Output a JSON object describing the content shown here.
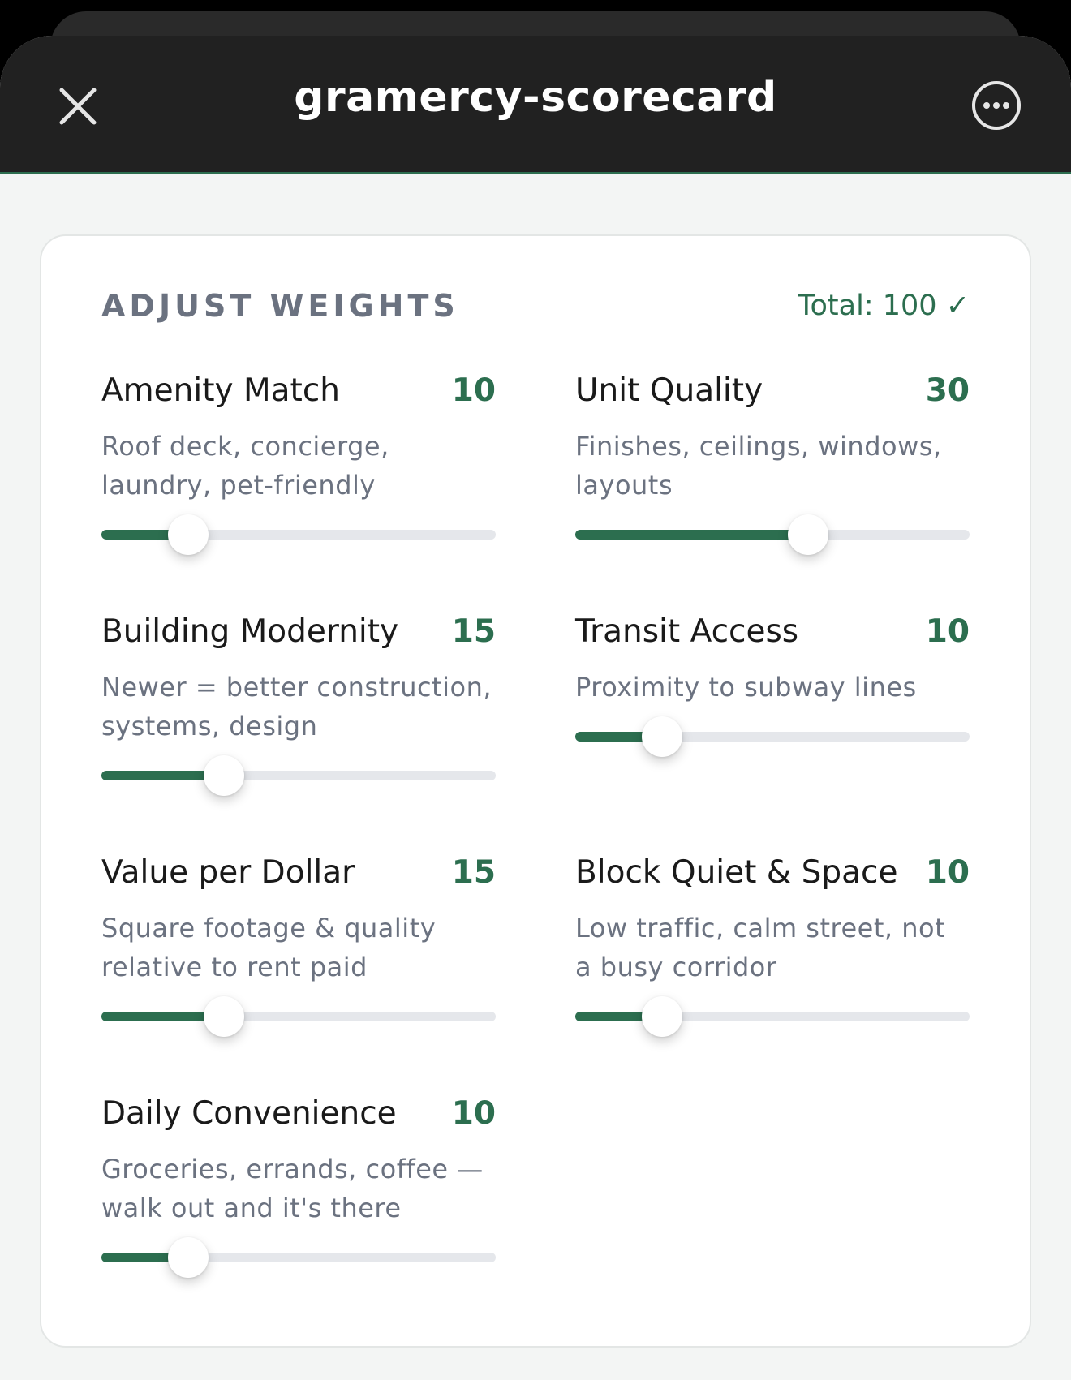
{
  "app": {
    "title": "gramercy-scorecard",
    "icons": {
      "close": "close-icon",
      "more": "more-options-icon"
    }
  },
  "card": {
    "section_label": "ADJUST WEIGHTS",
    "total_text": "Total: 100 ✓"
  },
  "weights": [
    {
      "name": "Amenity Match",
      "value": "10",
      "desc": "Roof deck, concierge, laundry, pet-friendly",
      "fraction": 0.22
    },
    {
      "name": "Unit Quality",
      "value": "30",
      "desc": "Finishes, ceilings, windows, layouts",
      "fraction": 0.59
    },
    {
      "name": "Building Modernity",
      "value": "15",
      "desc": "Newer = better construction, systems, design",
      "fraction": 0.31
    },
    {
      "name": "Transit Access",
      "value": "10",
      "desc": "Proximity to subway lines",
      "fraction": 0.22
    },
    {
      "name": "Value per Dollar",
      "value": "15",
      "desc": "Square footage & quality relative to rent paid",
      "fraction": 0.31
    },
    {
      "name": "Block Quiet & Space",
      "value": "10",
      "desc": "Low traffic, calm street, not a busy corridor",
      "fraction": 0.22
    },
    {
      "name": "Daily Convenience",
      "value": "10",
      "desc": "Groceries, errands, coffee — walk out and it's there",
      "fraction": 0.22
    }
  ],
  "colors": {
    "accent": "#2c6e4f",
    "track": "#e5e7eb",
    "topbar": "#212121",
    "background": "#f3f5f4"
  }
}
